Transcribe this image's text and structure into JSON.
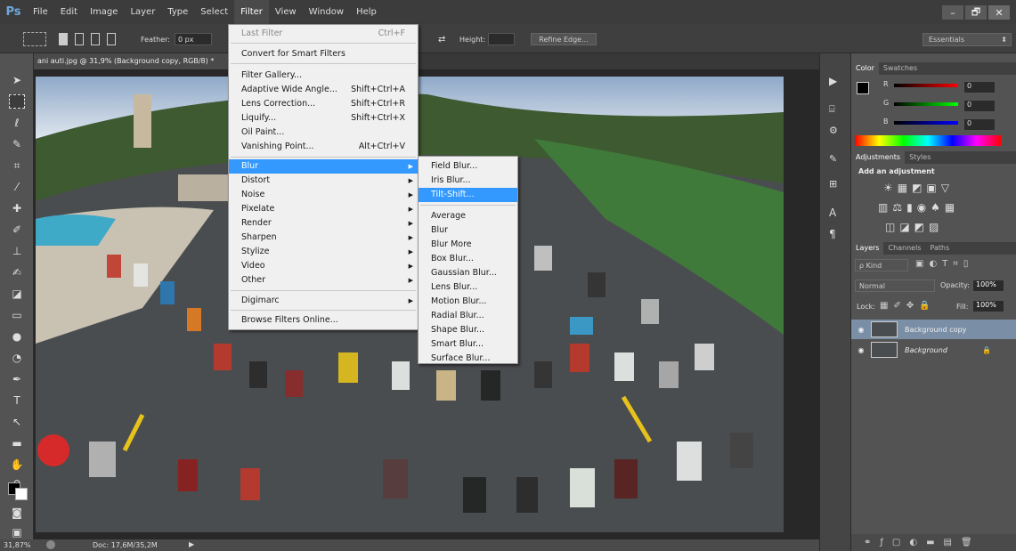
{
  "app_logo": "Ps",
  "menubar": [
    "File",
    "Edit",
    "Image",
    "Layer",
    "Type",
    "Select",
    "Filter",
    "View",
    "Window",
    "Help"
  ],
  "window_controls": {
    "minimize": "–",
    "restore": "🗗",
    "close": "✕"
  },
  "options_bar": {
    "feather_label": "Feather:",
    "feather_value": "0 px",
    "height_label": "Height:",
    "refine_edge": "Refine Edge...",
    "workspace": "Essentials"
  },
  "document_tab": "ani auti.jpg @ 31,9% (Background copy, RGB/8) *",
  "status": {
    "zoom": "31,87%",
    "doc": "Doc: 17,6M/35,2M"
  },
  "filter_menu": {
    "items": [
      {
        "label": "Last Filter",
        "shortcut": "Ctrl+F",
        "disabled": true
      },
      {
        "label": "Convert for Smart Filters"
      },
      {
        "label": "Filter Gallery..."
      },
      {
        "label": "Adaptive Wide Angle...",
        "shortcut": "Shift+Ctrl+A"
      },
      {
        "label": "Lens Correction...",
        "shortcut": "Shift+Ctrl+R"
      },
      {
        "label": "Liquify...",
        "shortcut": "Shift+Ctrl+X"
      },
      {
        "label": "Oil Paint..."
      },
      {
        "label": "Vanishing Point...",
        "shortcut": "Alt+Ctrl+V"
      },
      {
        "label": "Blur",
        "submenu": true
      },
      {
        "label": "Distort",
        "submenu": true
      },
      {
        "label": "Noise",
        "submenu": true
      },
      {
        "label": "Pixelate",
        "submenu": true
      },
      {
        "label": "Render",
        "submenu": true
      },
      {
        "label": "Sharpen",
        "submenu": true
      },
      {
        "label": "Stylize",
        "submenu": true
      },
      {
        "label": "Video",
        "submenu": true
      },
      {
        "label": "Other",
        "submenu": true
      },
      {
        "label": "Digimarc",
        "submenu": true
      },
      {
        "label": "Browse Filters Online..."
      }
    ]
  },
  "blur_submenu": {
    "items": [
      "Field Blur...",
      "Iris Blur...",
      "Tilt-Shift...",
      "Average",
      "Blur",
      "Blur More",
      "Box Blur...",
      "Gaussian Blur...",
      "Lens Blur...",
      "Motion Blur...",
      "Radial Blur...",
      "Shape Blur...",
      "Smart Blur...",
      "Surface Blur..."
    ]
  },
  "color_panel": {
    "tabs": [
      "Color",
      "Swatches"
    ],
    "channels": [
      {
        "label": "R",
        "value": "0",
        "color": "#d62020"
      },
      {
        "label": "G",
        "value": "0",
        "color": "#20b020"
      },
      {
        "label": "B",
        "value": "0",
        "color": "#2040e0"
      }
    ]
  },
  "adjustments_panel": {
    "tabs": [
      "Adjustments",
      "Styles"
    ],
    "heading": "Add an adjustment"
  },
  "layers_panel": {
    "tabs": [
      "Layers",
      "Channels",
      "Paths"
    ],
    "kind": "ρ Kind",
    "blend_mode": "Normal",
    "opacity_label": "Opacity:",
    "opacity_value": "100%",
    "lock_label": "Lock:",
    "fill_label": "Fill:",
    "fill_value": "100%",
    "layers": [
      {
        "name": "Background copy",
        "selected": true
      },
      {
        "name": "Background",
        "selected": false,
        "italic": true
      }
    ]
  },
  "colors": {
    "menu_highlight": "#3399ff",
    "panel_bg": "#535353"
  }
}
